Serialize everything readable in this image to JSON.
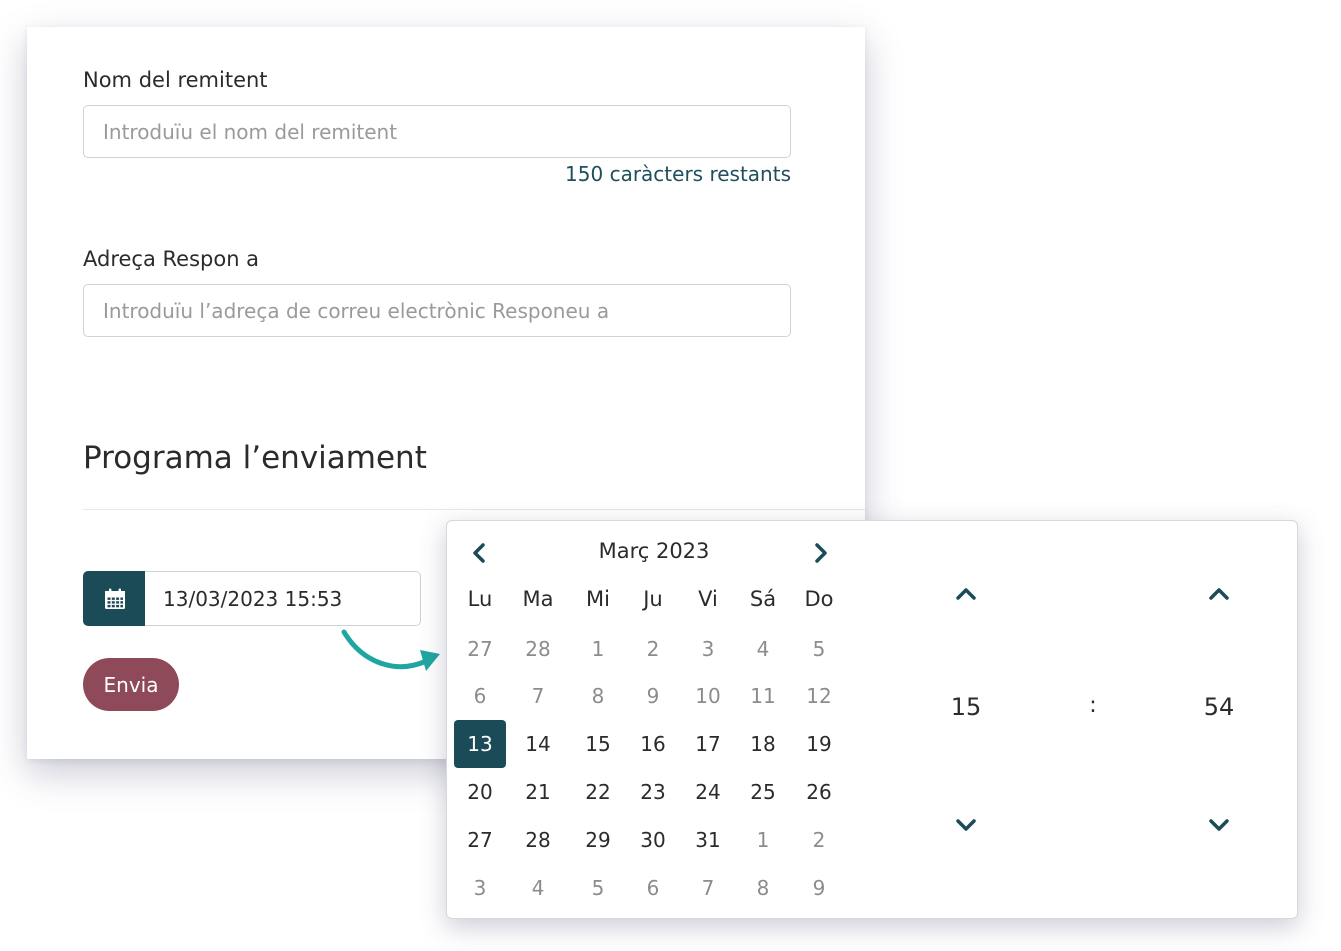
{
  "form": {
    "sender_name_label": "Nom del remitent",
    "sender_name_placeholder": "Introduïu el nom del remitent",
    "sender_name_counter": "150 caràcters restants",
    "reply_to_label": "Adreça Respon a",
    "reply_to_placeholder": "Introduïu l’adreça de correu electrònic Responeu a",
    "schedule_title": "Programa l’enviament",
    "datetime_value": "13/03/2023 15:53",
    "send_label": "Envia"
  },
  "datepicker": {
    "month_title": "Març 2023",
    "weekdays": [
      "Lu",
      "Ma",
      "Mi",
      "Ju",
      "Vi",
      "Sá",
      "Do"
    ],
    "weeks": [
      [
        {
          "d": "27",
          "m": true
        },
        {
          "d": "28",
          "m": true
        },
        {
          "d": "1",
          "m": true
        },
        {
          "d": "2",
          "m": true
        },
        {
          "d": "3",
          "m": true
        },
        {
          "d": "4",
          "m": true
        },
        {
          "d": "5",
          "m": true
        }
      ],
      [
        {
          "d": "6",
          "m": true
        },
        {
          "d": "7",
          "m": true
        },
        {
          "d": "8",
          "m": true
        },
        {
          "d": "9",
          "m": true
        },
        {
          "d": "10",
          "m": true
        },
        {
          "d": "11",
          "m": true
        },
        {
          "d": "12",
          "m": true
        }
      ],
      [
        {
          "d": "13",
          "sel": true
        },
        {
          "d": "14"
        },
        {
          "d": "15"
        },
        {
          "d": "16"
        },
        {
          "d": "17"
        },
        {
          "d": "18"
        },
        {
          "d": "19"
        }
      ],
      [
        {
          "d": "20"
        },
        {
          "d": "21"
        },
        {
          "d": "22"
        },
        {
          "d": "23"
        },
        {
          "d": "24"
        },
        {
          "d": "25"
        },
        {
          "d": "26"
        }
      ],
      [
        {
          "d": "27"
        },
        {
          "d": "28"
        },
        {
          "d": "29"
        },
        {
          "d": "30"
        },
        {
          "d": "31"
        },
        {
          "d": "1",
          "m": true
        },
        {
          "d": "2",
          "m": true
        }
      ],
      [
        {
          "d": "3",
          "m": true
        },
        {
          "d": "4",
          "m": true
        },
        {
          "d": "5",
          "m": true
        },
        {
          "d": "6",
          "m": true
        },
        {
          "d": "7",
          "m": true
        },
        {
          "d": "8",
          "m": true
        },
        {
          "d": "9",
          "m": true
        }
      ]
    ],
    "hour": "15",
    "minute": "54",
    "separator": ":"
  },
  "colors": {
    "primary": "#1b4b57",
    "send_button": "#8f4a5a",
    "arrow_accent": "#1fa6a0"
  },
  "icons": {
    "calendar": "calendar-icon",
    "prev": "chevron-left-icon",
    "next": "chevron-right-icon",
    "up": "chevron-up-icon",
    "down": "chevron-down-icon"
  }
}
